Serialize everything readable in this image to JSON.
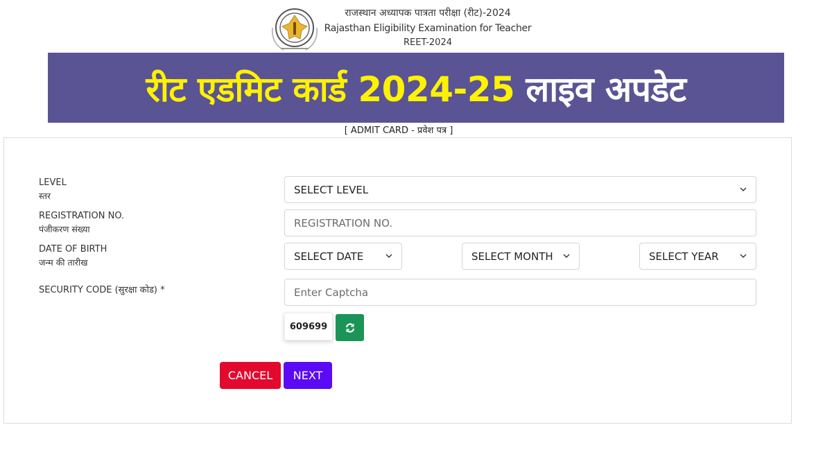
{
  "header": {
    "line_hindi": "राजस्थान अध्यापक पात्रता परीक्षा (रीट)-2024",
    "line_english": "Rajasthan Eligibility Examination for Teacher",
    "line_code": "REET-2024",
    "logo_icon": "reet-emblem-icon"
  },
  "banner": {
    "yellow_text": "रीट एडमिट कार्ड 2024-25",
    "white_text": "लाइव अपडेट",
    "background_color": "#5a5394",
    "yellow_color": "#fff200"
  },
  "subtitle": "[ ADMIT CARD - प्रवेश पत्र ]",
  "form": {
    "level": {
      "label_en": "LEVEL",
      "label_hi": "स्तर",
      "selected": "SELECT LEVEL"
    },
    "registration": {
      "label_en": "REGISTRATION NO.",
      "label_hi": "पंजीकरण संख्या",
      "placeholder": "REGISTRATION NO.",
      "value": ""
    },
    "dob": {
      "label_en": "DATE OF BIRTH",
      "label_hi": "जन्म की तारीख",
      "date_selected": "SELECT DATE",
      "month_selected": "SELECT MONTH",
      "year_selected": "SELECT YEAR"
    },
    "security": {
      "label": "SECURITY CODE (सुरक्षा कोड) *",
      "placeholder": "Enter Captcha",
      "value": "",
      "captcha_code": "609699",
      "refresh_icon": "refresh-icon"
    },
    "buttons": {
      "cancel_label": "CANCEL",
      "next_label": "NEXT",
      "cancel_color": "#e3082e",
      "next_color": "#5a0af5",
      "refresh_color": "#1b9457"
    }
  }
}
